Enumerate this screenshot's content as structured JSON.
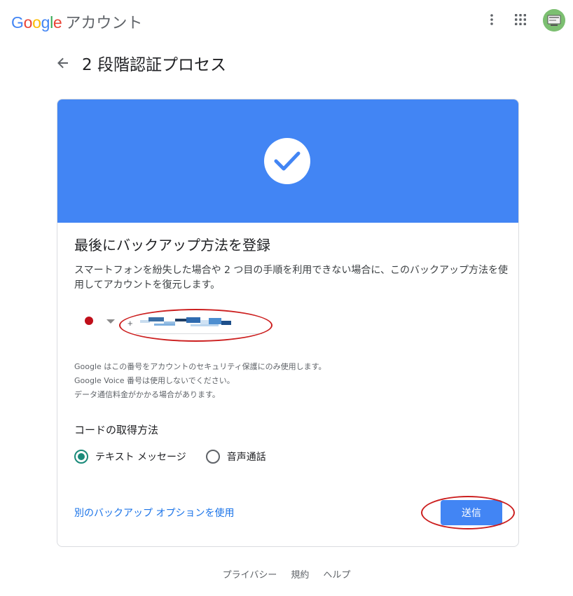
{
  "header": {
    "logo_letters": [
      {
        "char": "G",
        "color": "#4285f4"
      },
      {
        "char": "o",
        "color": "#ea4335"
      },
      {
        "char": "o",
        "color": "#fbbc05"
      },
      {
        "char": "g",
        "color": "#4285f4"
      },
      {
        "char": "l",
        "color": "#34a853"
      },
      {
        "char": "e",
        "color": "#ea4335"
      }
    ],
    "product": "アカウント",
    "icons": [
      "more-vert-icon",
      "apps-grid-icon",
      "avatar"
    ]
  },
  "page": {
    "back_icon": "arrow-back-icon",
    "title": "2 段階認証プロセス"
  },
  "card": {
    "banner_color": "#4285f4",
    "banner_icon": "check-circle-icon",
    "heading": "最後にバックアップ方法を登録",
    "description": "スマートフォンを紛失した場合や 2 つ目の手順を利用できない場合に、このバックアップ方法を使用してアカウントを復元します。",
    "phone": {
      "country_flag": "japan-flag-icon",
      "value": "+",
      "redacted": true
    },
    "notes": [
      "Google はこの番号をアカウントのセキュリティ保護にのみ使用します。",
      "Google Voice 番号は使用しないでください。",
      "データ通信料金がかかる場合があります。"
    ],
    "code_method": {
      "title": "コードの取得方法",
      "options": [
        {
          "label": "テキスト メッセージ",
          "selected": true
        },
        {
          "label": "音声通話",
          "selected": false
        }
      ]
    },
    "alt_link": "別のバックアップ オプションを使用",
    "send_label": "送信"
  },
  "footer": {
    "links": [
      "プライバシー",
      "規約",
      "ヘルプ"
    ]
  },
  "colors": {
    "accent": "#4285f4",
    "link": "#1a73e8",
    "radio_selected": "#1a8a7a",
    "annotation_red": "#cc1f1f"
  }
}
